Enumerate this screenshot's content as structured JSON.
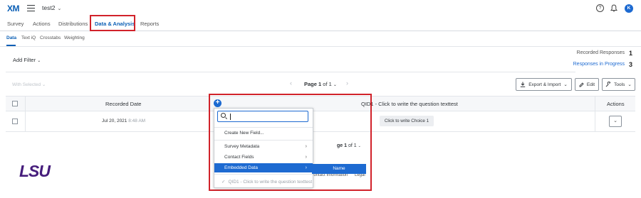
{
  "topbar": {
    "logo": "XM",
    "project": "test2",
    "avatar_initial": "K"
  },
  "main_tabs": [
    "Survey",
    "Actions",
    "Distributions",
    "Data & Analysis",
    "Reports"
  ],
  "sub_tabs": [
    "Data",
    "Text iQ",
    "Crosstabs",
    "Weighting"
  ],
  "filter": {
    "add_filter": "Add Filter"
  },
  "stats": {
    "recorded_label": "Recorded Responses",
    "recorded_value": "1",
    "progress_label": "Responses in Progress",
    "progress_value": "3"
  },
  "toolbar": {
    "with_selected": "With Selected",
    "page_prefix": "Page",
    "page_current": "1",
    "page_of": "of",
    "page_total": "1",
    "export_label": "Export & Import",
    "edit_label": "Edit",
    "tools_label": "Tools"
  },
  "table": {
    "headers": {
      "recorded_date": "Recorded Date",
      "question": "QID1 - Click to write the question texttest",
      "actions": "Actions"
    },
    "rows": [
      {
        "date": "Jul 20, 2021",
        "time": "8:48 AM",
        "choice": "Click to write Choice 1"
      }
    ],
    "bottom_pager_prefix": "ge",
    "bottom_pager_current": "1",
    "bottom_pager_of": "of",
    "bottom_pager_total": "1"
  },
  "menu": {
    "search_placeholder": "",
    "items": [
      {
        "label": "Create New Field..."
      },
      {
        "label": "Survey Metadata"
      },
      {
        "label": "Contact Fields"
      },
      {
        "label": "Embedded Data"
      },
      {
        "label": "QID1 - Click to write the question texttest"
      }
    ],
    "submenu_item": "Name"
  },
  "footer": {
    "logo": "LSU",
    "contact": "Contact Information",
    "legal": "Legal"
  },
  "colors": {
    "accent": "#1d6ad1",
    "highlight_box": "#d1222a",
    "lsu_purple": "#461d7c"
  }
}
